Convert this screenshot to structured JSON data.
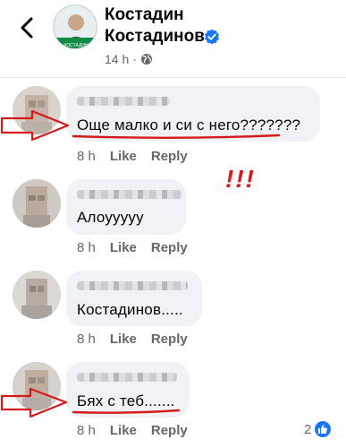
{
  "header": {
    "name": "Костадин Костадинов",
    "meta_time": "14 h",
    "meta_separator": "·",
    "avatar_text": "КОСТАДИН"
  },
  "comments": [
    {
      "text": "Още малко и си с него???????",
      "time": "8 h",
      "like": "Like",
      "reply": "Reply"
    },
    {
      "text": "Алоууууу",
      "time": "8 h",
      "like": "Like",
      "reply": "Reply"
    },
    {
      "text": "Костадинов.....",
      "time": "8 h",
      "like": "Like",
      "reply": "Reply"
    },
    {
      "text": "Бях с теб.......",
      "time": "8 h",
      "like": "Like",
      "reply": "Reply"
    }
  ],
  "annotation": {
    "exclaim": "!!!"
  },
  "reactions": {
    "count": "2"
  },
  "colors": {
    "accent": "#1877f2",
    "annotation": "#d41a1a",
    "bubble": "#f0f2f5",
    "meta": "#65676b"
  }
}
